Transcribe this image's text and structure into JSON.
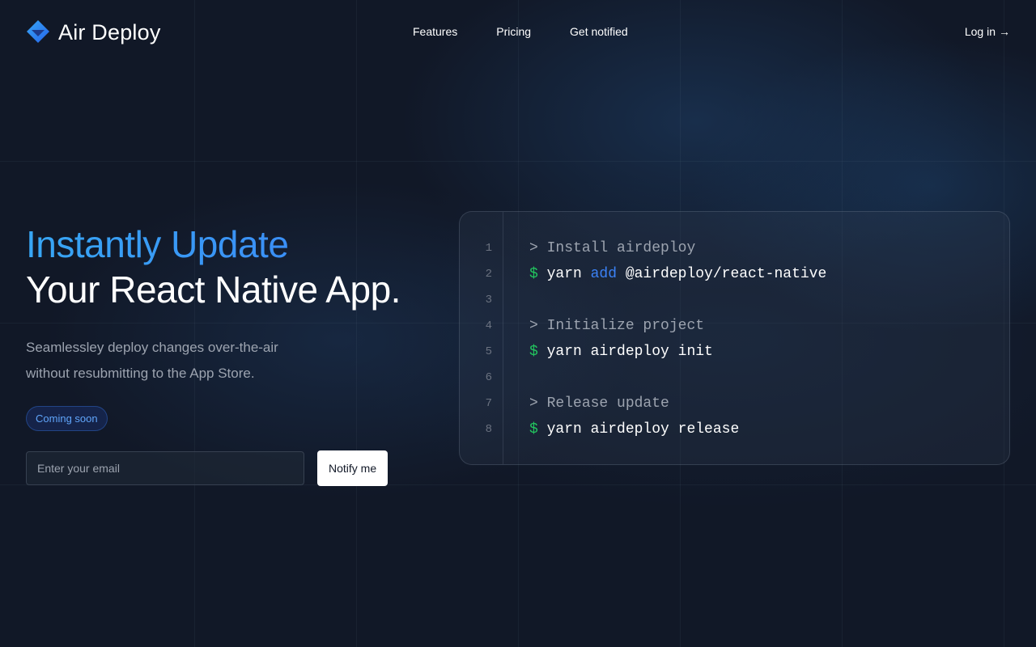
{
  "brand": {
    "name": "Air Deploy",
    "colors": {
      "accent": "#3b82f6",
      "accent_light": "#38a7f5",
      "success": "#22c55e",
      "background": "#111827"
    }
  },
  "nav": {
    "items": [
      {
        "label": "Features"
      },
      {
        "label": "Pricing"
      },
      {
        "label": "Get notified"
      }
    ]
  },
  "login": {
    "label": "Log in",
    "icon": "arrow-right-icon",
    "arrow": "→"
  },
  "hero": {
    "title_line1": "Instantly Update",
    "title_line2": "Your React Native App.",
    "subtitle": "Seamlessley deploy changes over-the-air without resubmitting to the App Store.",
    "badge": "Coming soon",
    "email_placeholder": "Enter your email",
    "email_value": "",
    "notify_label": "Notify me"
  },
  "code": {
    "lines": [
      {
        "num": "1",
        "prompt": "> ",
        "text": "Install airdeploy"
      },
      {
        "num": "2",
        "prompt": "$ ",
        "pre": "yarn ",
        "kw": "add",
        "post": " @airdeploy/react-native"
      },
      {
        "num": "3"
      },
      {
        "num": "4",
        "prompt": "> ",
        "text": "Initialize project"
      },
      {
        "num": "5",
        "prompt": "$ ",
        "text": "yarn airdeploy init"
      },
      {
        "num": "6"
      },
      {
        "num": "7",
        "prompt": "> ",
        "text": "Release update"
      },
      {
        "num": "8",
        "prompt": "$ ",
        "text": "yarn airdeploy release"
      }
    ]
  }
}
